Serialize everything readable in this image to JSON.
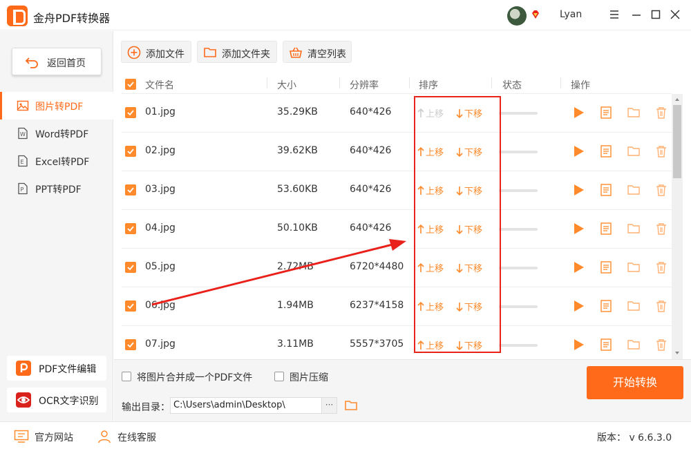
{
  "app": {
    "title": "金舟PDF转换器",
    "username": "Lyan"
  },
  "sidebar": {
    "home_label": "返回首页",
    "items": [
      {
        "label": "图片转PDF",
        "active": true
      },
      {
        "label": "Word转PDF",
        "active": false
      },
      {
        "label": "Excel转PDF",
        "active": false
      },
      {
        "label": "PPT转PDF",
        "active": false
      }
    ],
    "tools": [
      {
        "label": "PDF文件编辑"
      },
      {
        "label": "OCR文字识别"
      }
    ]
  },
  "toolbar": {
    "add_file": "添加文件",
    "add_folder": "添加文件夹",
    "clear_list": "清空列表"
  },
  "table": {
    "headers": {
      "name": "文件名",
      "size": "大小",
      "resolution": "分辨率",
      "order": "排序",
      "status": "状态",
      "actions": "操作"
    },
    "move_up": "上移",
    "move_down": "下移",
    "rows": [
      {
        "name": "01.jpg",
        "size": "35.29KB",
        "resolution": "640*426",
        "checked": true
      },
      {
        "name": "02.jpg",
        "size": "39.62KB",
        "resolution": "640*426",
        "checked": true
      },
      {
        "name": "03.jpg",
        "size": "53.60KB",
        "resolution": "640*426",
        "checked": true
      },
      {
        "name": "04.jpg",
        "size": "50.10KB",
        "resolution": "640*426",
        "checked": true
      },
      {
        "name": "05.jpg",
        "size": "2.72MB",
        "resolution": "6720*4480",
        "checked": true
      },
      {
        "name": "06.jpg",
        "size": "1.94MB",
        "resolution": "6237*4158",
        "checked": true
      },
      {
        "name": "07.jpg",
        "size": "3.11MB",
        "resolution": "5557*3705",
        "checked": true
      }
    ]
  },
  "options": {
    "merge_label": "将图片合并成一个PDF文件",
    "merge_checked": false,
    "compress_label": "图片压缩",
    "compress_checked": false
  },
  "output": {
    "label": "输出目录：",
    "path": "C:\\Users\\admin\\Desktop\\",
    "browse": "···"
  },
  "start_button": "开始转换",
  "footer": {
    "website": "官方网站",
    "support": "在线客服",
    "version": "版本： v 6.6.3.0"
  },
  "colors": {
    "accent": "#ff6a1a",
    "annotation": "#e8221a"
  }
}
